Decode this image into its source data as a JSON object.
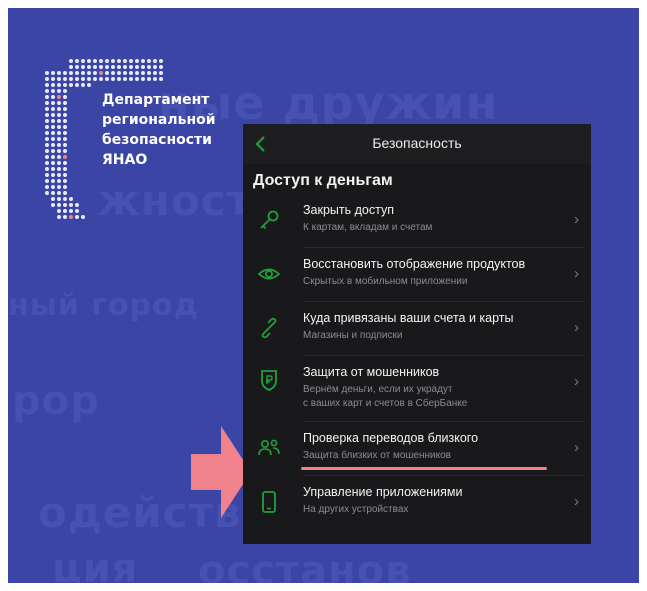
{
  "background": {
    "words": [
      "ные дружин",
      "жности",
      "ный город",
      "рор",
      "одейств",
      "ция",
      "осстанов"
    ]
  },
  "logo": {
    "lines": [
      "Департамент",
      "региональной",
      "безопасности",
      "ЯНАО"
    ]
  },
  "screen": {
    "title": "Безопасность",
    "section_title": "Доступ к деньгам",
    "items": [
      {
        "title": "Закрыть доступ",
        "subtitle": "К картам, вкладам и счетам",
        "icon": "key-icon"
      },
      {
        "title": "Восстановить отображение продуктов",
        "subtitle": "Скрытых в мобильном приложении",
        "icon": "eye-icon"
      },
      {
        "title": "Куда привязаны ваши счета и карты",
        "subtitle": "Магазины и подписки",
        "icon": "link-icon"
      },
      {
        "title": "Защита от мошенников",
        "subtitle": "Вернём деньги, если их украдут",
        "subtitle2": "с ваших карт и счетов в СберБанке",
        "icon": "shield-ruble-icon"
      },
      {
        "title": "Проверка переводов близкого",
        "subtitle": "Защита близких от мошенников",
        "icon": "people-icon"
      },
      {
        "title": "Управление приложениями",
        "subtitle": "На других устройствах",
        "icon": "phone-icon"
      }
    ],
    "chevron": "›"
  },
  "colors": {
    "slide_bg": "#3a45a6",
    "phone_bg": "#19191b",
    "accent_green": "#21a038",
    "highlight": "#f0828c"
  }
}
